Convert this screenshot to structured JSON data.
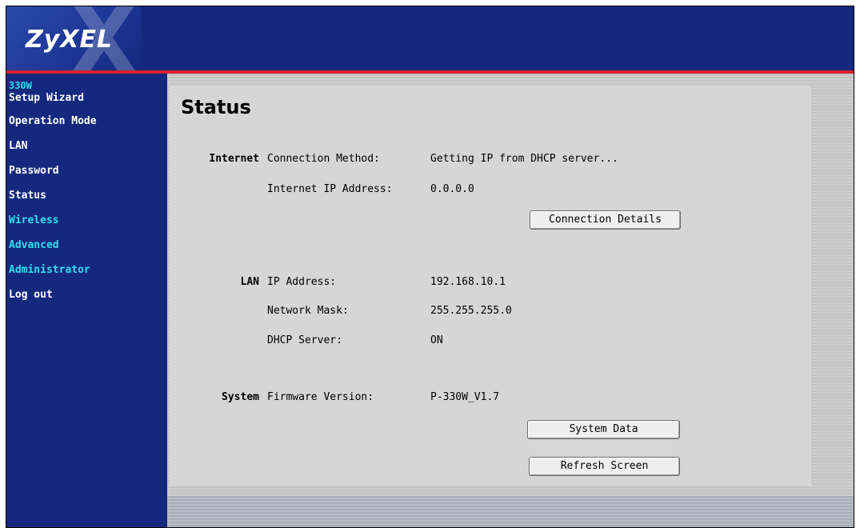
{
  "header": {
    "logo_text": "ZyXEL"
  },
  "sidebar": {
    "model": "330W",
    "items": [
      {
        "label": "Setup Wizard",
        "color": "#ffffff"
      },
      {
        "label": "Operation Mode",
        "color": "#ffffff"
      },
      {
        "label": "LAN",
        "color": "#ffffff"
      },
      {
        "label": "Password",
        "color": "#ffffff"
      },
      {
        "label": "Status",
        "color": "#ffffff"
      },
      {
        "label": "Wireless",
        "color": "#33ddee"
      },
      {
        "label": "Advanced",
        "color": "#33ddee"
      },
      {
        "label": "Administrator",
        "color": "#33ddee"
      },
      {
        "label": "Log out",
        "color": "#ffffff"
      }
    ]
  },
  "main": {
    "title": "Status",
    "internet": {
      "section_label": "Internet",
      "connection_method_label": "Connection Method:",
      "connection_method_value": "Getting IP from DHCP server...",
      "ip_label": "Internet IP Address:",
      "ip_value": "0.0.0.0",
      "details_button": "Connection Details"
    },
    "lan": {
      "section_label": "LAN",
      "ip_label": "IP Address:",
      "ip_value": "192.168.10.1",
      "mask_label": "Network Mask:",
      "mask_value": "255.255.255.0",
      "dhcp_label": "DHCP Server:",
      "dhcp_value": "ON"
    },
    "system": {
      "section_label": "System",
      "firmware_label": "Firmware Version:",
      "firmware_value": "P-330W_V1.7",
      "system_data_button": "System Data",
      "refresh_button": "Refresh Screen"
    }
  },
  "colors": {
    "navy": "#14297e",
    "accent_red": "#d8202a",
    "cyan_link": "#33ddee",
    "panel": "#d6d6d6"
  }
}
